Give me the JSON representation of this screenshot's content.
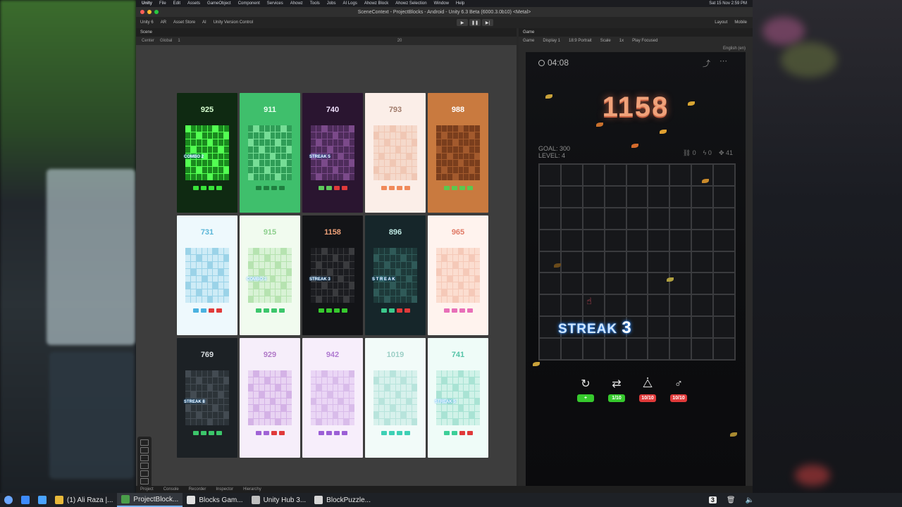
{
  "mac_menubar": {
    "app": "Unity",
    "items": [
      "File",
      "Edit",
      "Assets",
      "GameObject",
      "Component",
      "Services",
      "Ahowz",
      "Tools",
      "Jobs",
      "AI Logs",
      "Ahowz Block",
      "Ahowz Selection",
      "Window",
      "Help"
    ],
    "clock": "Sat 15 Nov 2:59 PM"
  },
  "window": {
    "title": "SceneContext - ProjectBlocks - Android - Unity 6.3 Beta (6000.3.0b10) <Metal>"
  },
  "toolbar": {
    "account": "Unity 6",
    "ai_account": "AR",
    "asset_store": "Asset Store",
    "ai": "AI",
    "version_control": "Unity Version Control",
    "play": "▶",
    "pause": "❚❚",
    "step": "▶|",
    "layout": "Layout",
    "platform": "Mobile"
  },
  "scene_panel": {
    "tab": "Scene",
    "pivot": "Center",
    "space": "Global",
    "snap": "1",
    "zoom_value": "20"
  },
  "game_panel": {
    "tab": "Game",
    "mode": "Game",
    "display": "Display 1",
    "aspect": "18:9 Portrait",
    "scale_label": "Scale",
    "scale_value": "1x",
    "play_focused": "Play Focused",
    "language": "English (en)"
  },
  "game": {
    "timer": "04:08",
    "score": "1158",
    "goal": "GOAL: 300",
    "level": "LEVEL: 4",
    "counters": [
      "0",
      "0",
      "41"
    ],
    "streak_label": "STREAK",
    "streak_num": "3",
    "powerups": [
      {
        "icon": "rotate-icon",
        "glyph": "↻",
        "label": "+",
        "color": "#36c92d"
      },
      {
        "icon": "swap-icon",
        "glyph": "⇄",
        "label": "1/10",
        "color": "#36c92d"
      },
      {
        "icon": "shapes-icon",
        "glyph": "⧊",
        "label": "10/10",
        "color": "#e03a3a"
      },
      {
        "icon": "bomb-icon",
        "glyph": "♂",
        "label": "10/10",
        "color": "#e03a3a"
      }
    ]
  },
  "cards": [
    {
      "score": "925",
      "bg": "#0f2a12",
      "score_color": "#d7ffd0",
      "cell": "#1a8a1e",
      "line": "#53ff52",
      "pieces": "#39e33a",
      "streak": "COMBO 2"
    },
    {
      "score": "911",
      "bg": "#3fbf6c",
      "score_color": "#e8fff0",
      "cell": "#2f9d57",
      "line": "#76dd96",
      "pieces": "#1f7f3f",
      "streak": ""
    },
    {
      "score": "740",
      "bg": "#2a1530",
      "score_color": "#f2e3ff",
      "cell": "#4e2c5b",
      "line": "#7b4a8a",
      "pieces": "#5ec95b",
      "streak": "STREAK 5"
    },
    {
      "score": "793",
      "bg": "#fbeee8",
      "score_color": "#a07a6a",
      "cell": "#f5d9cb",
      "line": "#f0c7b4",
      "pieces": "#f08a5a",
      "streak": ""
    },
    {
      "score": "988",
      "bg": "#c97a3f",
      "score_color": "#ffffff",
      "cell": "#7a3e1d",
      "line": "#a35a2d",
      "pieces": "#5bc84f",
      "streak": ""
    },
    {
      "score": "731",
      "bg": "#eef9fd",
      "score_color": "#5ab6d8",
      "cell": "#cdebf6",
      "line": "#9bd3e8",
      "pieces": "#4ab2e0",
      "streak": ""
    },
    {
      "score": "915",
      "bg": "#f1fbef",
      "score_color": "#8dcf8d",
      "cell": "#d8f2d5",
      "line": "#b6e3b0",
      "pieces": "#3cc66b",
      "streak": "COMBO 3"
    },
    {
      "score": "1158",
      "bg": "#131417",
      "score_color": "#f0a27a",
      "cell": "#1c1d21",
      "line": "#3a3b3e",
      "pieces": "#36c92d",
      "streak": "STREAK 3"
    },
    {
      "score": "896",
      "bg": "#16262a",
      "score_color": "#bfe9e3",
      "cell": "#1e3a3a",
      "line": "#2f5a58",
      "pieces": "#3cc98c",
      "streak": "S T R E A K"
    },
    {
      "score": "965",
      "bg": "#fff3ee",
      "score_color": "#e07a66",
      "cell": "#fbddd0",
      "line": "#f5c9b8",
      "pieces": "#e86fb8",
      "streak": ""
    },
    {
      "score": "769",
      "bg": "#1c2125",
      "score_color": "#d8dde0",
      "cell": "#2c3338",
      "line": "#434b52",
      "pieces": "#3cc66b",
      "streak": "STREAK 8"
    },
    {
      "score": "929",
      "bg": "#f6eefa",
      "score_color": "#b17ac8",
      "cell": "#e8d3f2",
      "line": "#d4b2e6",
      "pieces": "#a063d6",
      "streak": ""
    },
    {
      "score": "942",
      "bg": "#f7eefb",
      "score_color": "#b07ad1",
      "cell": "#ead6f5",
      "line": "#d9bcea",
      "pieces": "#9b5fd6",
      "streak": ""
    },
    {
      "score": "1019",
      "bg": "#f2fbf9",
      "score_color": "#9ccfc6",
      "cell": "#d7f1ec",
      "line": "#b8e4dc",
      "pieces": "#3ed0b5",
      "streak": ""
    },
    {
      "score": "741",
      "bg": "#effcf8",
      "score_color": "#55c4a8",
      "cell": "#d0f2e8",
      "line": "#a9e3d4",
      "pieces": "#3ccf98",
      "streak": "STREAK 5"
    }
  ],
  "bottom_tabs": [
    "Project",
    "Console",
    "Recorder",
    "Inspector",
    "Hierarchy"
  ],
  "taskbar": {
    "items": [
      {
        "label": "(1) Ali Raza |...",
        "icon": "chrome-icon",
        "color": "#e8b93a"
      },
      {
        "label": "ProjectBlock...",
        "icon": "unity-project-icon",
        "color": "#4a9e4a"
      },
      {
        "label": "Blocks Gam...",
        "icon": "blocks-app-icon",
        "color": "#e0e0e0"
      },
      {
        "label": "Unity Hub 3...",
        "icon": "unity-hub-icon",
        "color": "#bfbfbf"
      },
      {
        "label": "BlockPuzzle...",
        "icon": "block-puzzle-icon",
        "color": "#d6d6d6"
      }
    ],
    "badge": "3"
  }
}
